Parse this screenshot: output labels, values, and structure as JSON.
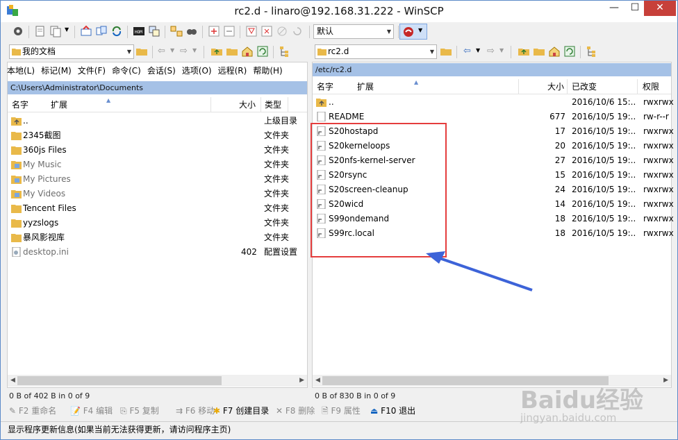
{
  "window": {
    "title": "rc2.d - linaro@192.168.31.222 - WinSCP",
    "minimize": "—",
    "maximize": "☐",
    "close": "✕"
  },
  "toolbar": {
    "session_select": "默认"
  },
  "left": {
    "location": "我的文档",
    "menu": [
      "本地(L)",
      "标记(M)",
      "文件(F)",
      "命令(C)",
      "会话(S)",
      "选项(O)",
      "远程(R)",
      "帮助(H)"
    ],
    "path": "C:\\Users\\Administrator\\Documents",
    "columns": {
      "name": "名字",
      "ext": "扩展",
      "size": "大小",
      "type": "类型"
    },
    "files": [
      {
        "name": "..",
        "size": "",
        "type": "上级目录",
        "icon": "parent-dir-icon"
      },
      {
        "name": "2345截图",
        "size": "",
        "type": "文件夹",
        "icon": "folder-icon"
      },
      {
        "name": "360js Files",
        "size": "",
        "type": "文件夹",
        "icon": "folder-icon"
      },
      {
        "name": "My Music",
        "size": "",
        "type": "文件夹",
        "icon": "folder-special-icon"
      },
      {
        "name": "My Pictures",
        "size": "",
        "type": "文件夹",
        "icon": "folder-special-icon"
      },
      {
        "name": "My Videos",
        "size": "",
        "type": "文件夹",
        "icon": "folder-special-icon"
      },
      {
        "name": "Tencent Files",
        "size": "",
        "type": "文件夹",
        "icon": "folder-icon"
      },
      {
        "name": "yyzslogs",
        "size": "",
        "type": "文件夹",
        "icon": "folder-icon"
      },
      {
        "name": "暴风影视库",
        "size": "",
        "type": "文件夹",
        "icon": "folder-icon"
      },
      {
        "name": "desktop.ini",
        "size": "402",
        "type": "配置设置",
        "icon": "config-file-icon"
      }
    ],
    "status": "0 B of 402 B in 0 of 9"
  },
  "right": {
    "location": "rc2.d",
    "path": "/etc/rc2.d",
    "columns": {
      "name": "名字",
      "ext": "扩展",
      "size": "大小",
      "changed": "已改变",
      "rights": "权限"
    },
    "files": [
      {
        "name": "..",
        "size": "",
        "changed": "2016/10/6 15:..",
        "rights": "rwxrwx",
        "icon": "parent-dir-icon"
      },
      {
        "name": "README",
        "size": "677",
        "changed": "2016/10/5 19:..",
        "rights": "rw-r--r",
        "icon": "file-icon"
      },
      {
        "name": "S20hostapd",
        "size": "17",
        "changed": "2016/10/5 19:..",
        "rights": "rwxrwx",
        "icon": "symlink-icon"
      },
      {
        "name": "S20kerneloops",
        "size": "20",
        "changed": "2016/10/5 19:..",
        "rights": "rwxrwx",
        "icon": "symlink-icon"
      },
      {
        "name": "S20nfs-kernel-server",
        "size": "27",
        "changed": "2016/10/5 19:..",
        "rights": "rwxrwx",
        "icon": "symlink-icon"
      },
      {
        "name": "S20rsync",
        "size": "15",
        "changed": "2016/10/5 19:..",
        "rights": "rwxrwx",
        "icon": "symlink-icon"
      },
      {
        "name": "S20screen-cleanup",
        "size": "24",
        "changed": "2016/10/5 19:..",
        "rights": "rwxrwx",
        "icon": "symlink-icon"
      },
      {
        "name": "S20wicd",
        "size": "14",
        "changed": "2016/10/5 19:..",
        "rights": "rwxrwx",
        "icon": "symlink-icon"
      },
      {
        "name": "S99ondemand",
        "size": "18",
        "changed": "2016/10/5 19:..",
        "rights": "rwxrwx",
        "icon": "symlink-icon"
      },
      {
        "name": "S99rc.local",
        "size": "18",
        "changed": "2016/10/5 19:..",
        "rights": "rwxrwx",
        "icon": "symlink-icon"
      }
    ],
    "status": "0 B of 830 B in 0 of 9"
  },
  "fkeys": [
    {
      "label": "F2 重命名",
      "enabled": false
    },
    {
      "label": "F4 编辑",
      "enabled": false
    },
    {
      "label": "F5 复制",
      "enabled": false
    },
    {
      "label": "F6 移动",
      "enabled": false
    },
    {
      "label": "F7 创建目录",
      "enabled": true
    },
    {
      "label": "F8 删除",
      "enabled": false
    },
    {
      "label": "F9 属性",
      "enabled": false
    },
    {
      "label": "F10 退出",
      "enabled": true
    }
  ],
  "bottom_message": "显示程序更新信息(如果当前无法获得更新，请访问程序主页)",
  "watermark": {
    "brand": "Baidu经验",
    "url": "jingyan.baidu.com"
  },
  "colors": {
    "path_bar": "#a5c1e6",
    "highlight_box": "#e53d3d",
    "arrow": "#3d63d8",
    "close_button": "#c7403a"
  }
}
